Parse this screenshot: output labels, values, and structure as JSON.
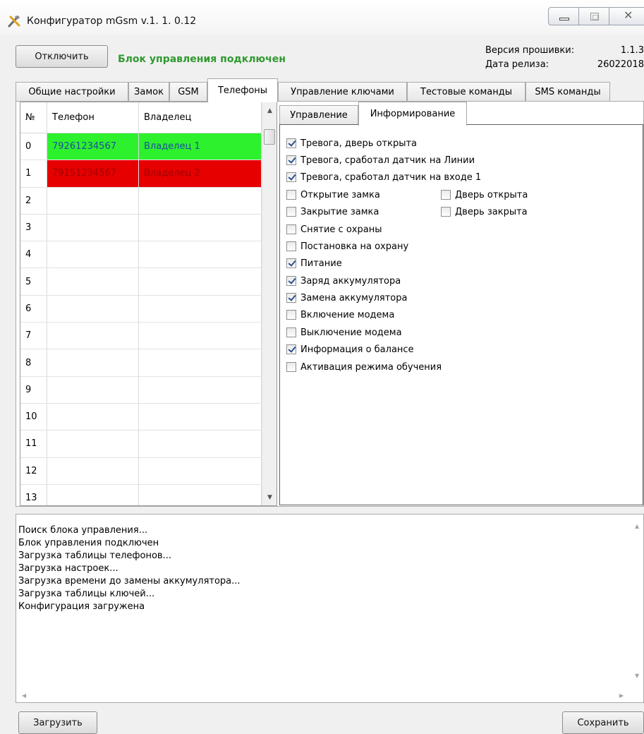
{
  "window": {
    "title": "Конфигуратор mGsm v.1. 1. 0.12",
    "close_glyph": "✕"
  },
  "header": {
    "disconnect_label": "Отключить",
    "status": "Блок управления подключен",
    "status_color": "#2f9a2f",
    "firmware_label": "Версия прошивки:",
    "firmware_value": "1.1.3",
    "release_label": "Дата релиза:",
    "release_value": "26022018"
  },
  "tabs": [
    {
      "label": "Общие настройки",
      "active": false
    },
    {
      "label": "Замок",
      "active": false
    },
    {
      "label": "GSM",
      "active": false
    },
    {
      "label": "Телефоны",
      "active": true
    },
    {
      "label": "Управление ключами",
      "active": false
    },
    {
      "label": "Тестовые команды",
      "active": false
    },
    {
      "label": "SMS команды",
      "active": false
    }
  ],
  "phones": {
    "columns": [
      "№",
      "Телефон",
      "Владелец"
    ],
    "rows": [
      {
        "n": "0",
        "phone": "79261234567",
        "owner": "Владелец 1",
        "state": "green"
      },
      {
        "n": "1",
        "phone": "79151234567",
        "owner": "Владелец 2",
        "state": "red"
      },
      {
        "n": "2",
        "phone": "",
        "owner": ""
      },
      {
        "n": "3",
        "phone": "",
        "owner": ""
      },
      {
        "n": "4",
        "phone": "",
        "owner": ""
      },
      {
        "n": "5",
        "phone": "",
        "owner": ""
      },
      {
        "n": "6",
        "phone": "",
        "owner": ""
      },
      {
        "n": "7",
        "phone": "",
        "owner": ""
      },
      {
        "n": "8",
        "phone": "",
        "owner": ""
      },
      {
        "n": "9",
        "phone": "",
        "owner": ""
      },
      {
        "n": "10",
        "phone": "",
        "owner": ""
      },
      {
        "n": "11",
        "phone": "",
        "owner": ""
      },
      {
        "n": "12",
        "phone": "",
        "owner": ""
      },
      {
        "n": "13",
        "phone": "",
        "owner": ""
      }
    ],
    "row_colors": {
      "green": "#2df12d",
      "red": "#e60000"
    }
  },
  "subtabs": [
    {
      "label": "Управление",
      "active": false
    },
    {
      "label": "Информирование",
      "active": true
    }
  ],
  "notifications": {
    "left": [
      {
        "label": "Тревога, дверь открыта",
        "checked": true
      },
      {
        "label": "Тревога, сработал датчик на Линии",
        "checked": true
      },
      {
        "label": "Тревога, сработал датчик на входе 1",
        "checked": true
      },
      {
        "label": "Открытие замка",
        "checked": false
      },
      {
        "label": "Закрытие замка",
        "checked": false
      },
      {
        "label": "Снятие с охраны",
        "checked": false
      },
      {
        "label": "Постановка на охрану",
        "checked": false
      },
      {
        "label": "Питание",
        "checked": true
      },
      {
        "label": "Заряд аккумулятора",
        "checked": true
      },
      {
        "label": "Замена аккумулятора",
        "checked": true
      },
      {
        "label": "Включение модема",
        "checked": false
      },
      {
        "label": "Выключение модема",
        "checked": false
      },
      {
        "label": "Информация о балансе",
        "checked": true
      },
      {
        "label": "Активация режима обучения",
        "checked": false
      }
    ],
    "right": [
      {
        "label": "Дверь открыта",
        "checked": false
      },
      {
        "label": "Дверь закрыта",
        "checked": false
      }
    ]
  },
  "log": {
    "lines": [
      "Поиск блока управления...",
      "Блок управления подключен",
      "Загрузка таблицы телефонов...",
      "Загрузка настроек...",
      "Загрузка времени до замены аккумулятора...",
      "Загрузка таблицы ключей...",
      "Конфигурация загружена"
    ]
  },
  "footer": {
    "load_label": "Загрузить",
    "save_label": "Сохранить"
  }
}
